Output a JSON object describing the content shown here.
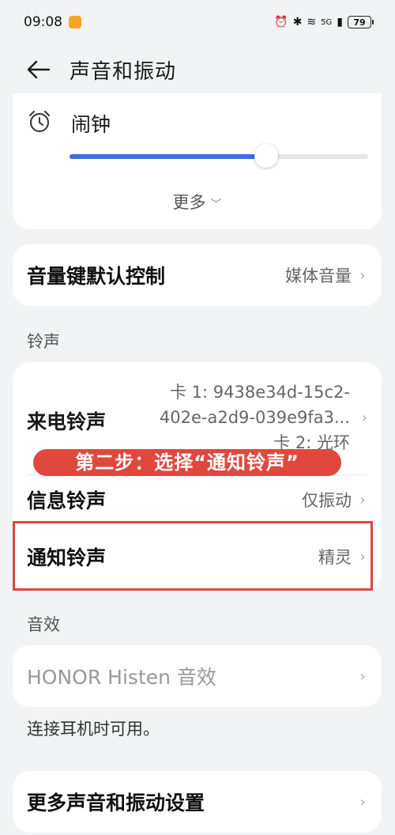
{
  "status_bar": {
    "time": "09:08",
    "network": "5G",
    "battery": "79"
  },
  "header": {
    "title": "声音和振动"
  },
  "alarm": {
    "label": "闹钟",
    "volume_fraction": 0.66,
    "more_label": "更多"
  },
  "volume_key": {
    "label": "音量键默认控制",
    "value": "媒体音量"
  },
  "ringtone_section": {
    "title": "铃声",
    "call_ringtone": {
      "label": "来电铃声",
      "value_lines": [
        "卡 1: 9438e34d-15c2-",
        "402e-a2d9-039e9fa3...",
        "卡 2: 光环"
      ]
    },
    "message_ringtone": {
      "label": "信息铃声",
      "value": "仅振动"
    },
    "notification_ringtone": {
      "label": "通知铃声",
      "value": "精灵"
    }
  },
  "annotation": {
    "text": "第二步：选择“通知铃声”"
  },
  "effects_section": {
    "title": "音效",
    "histen": {
      "label": "HONOR Histen 音效"
    },
    "helper": "连接耳机时可用。"
  },
  "more_settings": {
    "label": "更多声音和振动设置"
  },
  "colors": {
    "accent": "#3a6fe0",
    "annotation_red": "#e0483e"
  }
}
